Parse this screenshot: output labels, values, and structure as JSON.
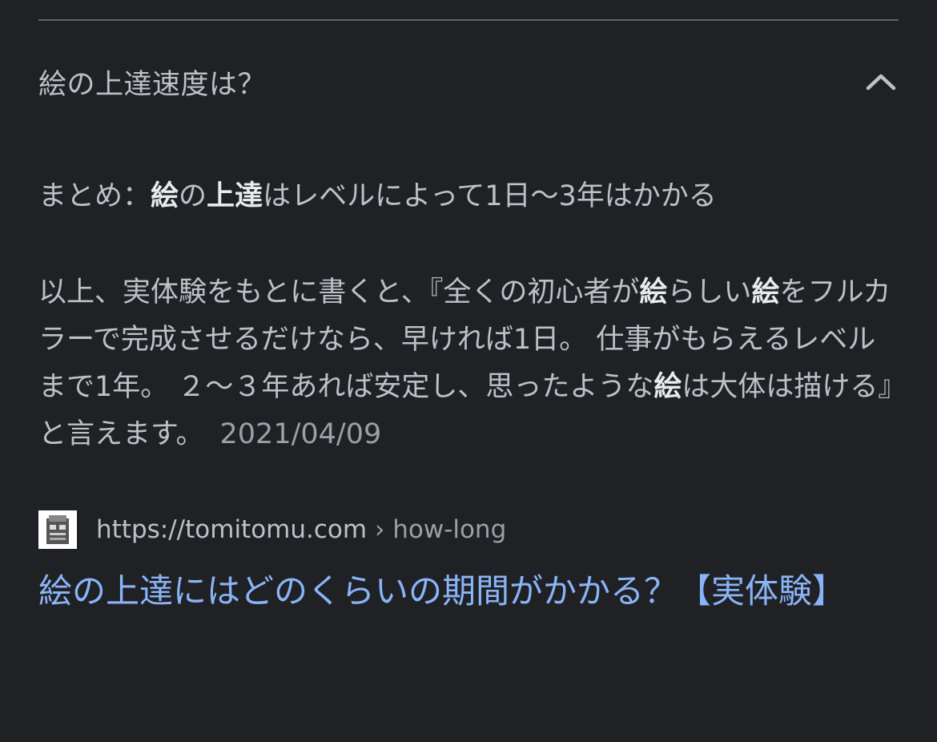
{
  "question": "絵の上達速度は？",
  "summary": {
    "p1": "まとめ：",
    "b1": "絵",
    "p2": "の",
    "b2": "上達",
    "p3": "はレベルによって1日〜3年はかかる"
  },
  "answer": {
    "s1": "以上、実体験をもとに書くと、『全くの初心者が",
    "b1": "絵",
    "s2": "らしい",
    "b2": "絵",
    "s3": "をフルカラーで完成させるだけなら、早ければ1日。 仕事がもらえるレベルまで1年。 ２〜３年あれば安定し、思ったような",
    "b3": "絵",
    "s4": "は大体は描ける』と言えます。",
    "date": "2021/04/09"
  },
  "source": {
    "domain": "https://tomitomu.com",
    "separator": " › ",
    "path": "how-long"
  },
  "result_title": "絵の上達にはどのくらいの期間がかかる？【実体験】",
  "icons": {
    "collapse": "chevron-up-icon",
    "site": "favicon-icon"
  },
  "colors": {
    "background": "#202124",
    "text": "#bdc1c6",
    "link": "#8ab4f8",
    "divider": "#5f6368"
  }
}
